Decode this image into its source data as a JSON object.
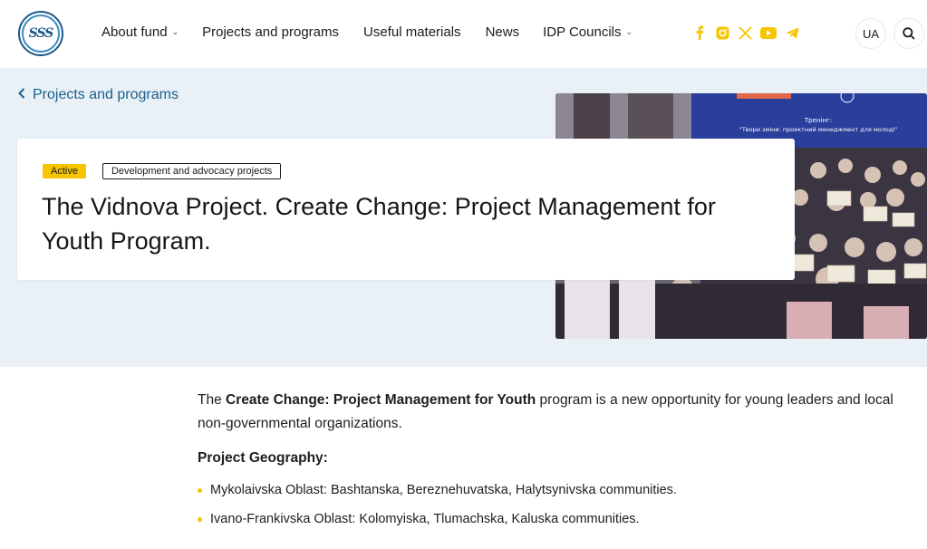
{
  "header": {
    "logo_text": "SSS",
    "nav": [
      {
        "label": "About fund",
        "has_dropdown": true
      },
      {
        "label": "Projects and programs",
        "has_dropdown": false
      },
      {
        "label": "Useful materials",
        "has_dropdown": false
      },
      {
        "label": "News",
        "has_dropdown": false
      },
      {
        "label": "IDP Councils",
        "has_dropdown": true
      }
    ],
    "socials": [
      "facebook-icon",
      "instagram-icon",
      "x-icon",
      "youtube-icon",
      "telegram-icon"
    ],
    "social_color": "#f6c500",
    "language": "UA"
  },
  "breadcrumb": {
    "back_label": "Projects and programs"
  },
  "project": {
    "status": "Active",
    "category": "Development and advocacy projects",
    "title": "The Vidnova Project. Create Change: Project Management for Youth Program.",
    "photo_banner_text": "Тренінг: \"Твори зміни: проектний менеджмент для молоді\""
  },
  "content": {
    "intro_prefix": "The ",
    "intro_bold": "Create Change: Project Management for Youth",
    "intro_suffix": " program is a new opportunity for young leaders and local non-governmental organizations.",
    "geography_heading": "Project Geography:",
    "geography": [
      "Mykolaivska Oblast: Bashtanska, Bereznehuvatska, Halytsynivska communities.",
      "Ivano-Frankivska Oblast: Kolomyiska, Tlumachska, Kaluska communities."
    ]
  },
  "colors": {
    "accent": "#1a5f8f",
    "badge": "#f6c500",
    "hero_bg": "#e9f1f6"
  }
}
